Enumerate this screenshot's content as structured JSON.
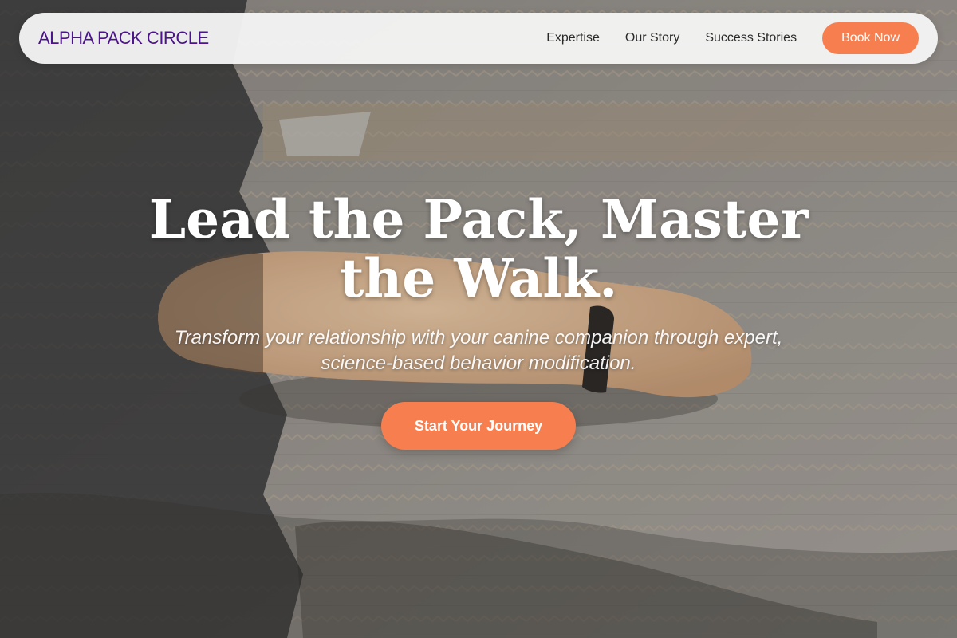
{
  "navbar": {
    "brand": "ALPHA PACK CIRCLE",
    "links": [
      "Expertise",
      "Our Story",
      "Success Stories"
    ],
    "book_label": "Book Now"
  },
  "hero": {
    "title": "Lead the Pack, Master the Walk.",
    "subtitle": "Transform your relationship with your canine companion through expert, science-based behavior modification.",
    "cta_label": "Start Your Journey",
    "background_image": "dog-lying-on-paved-street-photo"
  },
  "colors": {
    "brand": "#4b148a",
    "accent": "#f77f4f",
    "navbar_bg": "#f5f5f5",
    "hero_text": "#ffffff"
  }
}
